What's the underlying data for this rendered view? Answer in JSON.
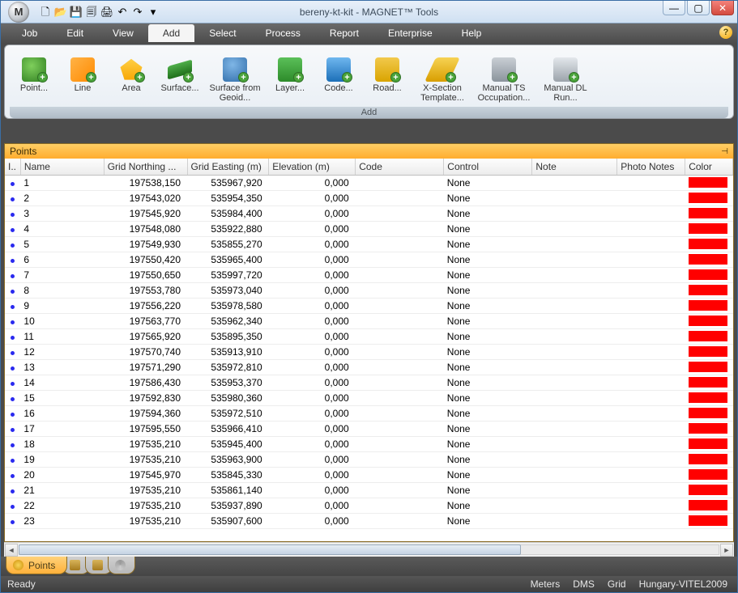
{
  "titlebar": {
    "app_initial": "M",
    "title": "bereny-kt-kit - MAGNET™ Tools",
    "qat": [
      "🗋",
      "📂",
      "💾",
      "🗐",
      "🖨",
      "↶",
      "↷",
      "▾"
    ]
  },
  "window_controls": {
    "min": "—",
    "max": "▢",
    "close": "✕"
  },
  "menu": {
    "items": [
      "Job",
      "Edit",
      "View",
      "Add",
      "Select",
      "Process",
      "Report",
      "Enterprise",
      "Help"
    ],
    "active": "Add",
    "help_icon": "?"
  },
  "ribbon": {
    "caption": "Add",
    "items": [
      {
        "label": "Point...",
        "icon": "ic-point"
      },
      {
        "label": "Line",
        "icon": "ic-line"
      },
      {
        "label": "Area",
        "icon": "ic-area"
      },
      {
        "label": "Surface...",
        "icon": "ic-surf"
      },
      {
        "label": "Surface from Geoid...",
        "icon": "ic-geoid",
        "wide": true
      },
      {
        "label": "Layer...",
        "icon": "ic-layer"
      },
      {
        "label": "Code...",
        "icon": "ic-code"
      },
      {
        "label": "Road...",
        "icon": "ic-road"
      },
      {
        "label": "X-Section Template...",
        "icon": "ic-xsec",
        "wide": true
      },
      {
        "label": "Manual TS Occupation...",
        "icon": "ic-ts",
        "wide": true
      },
      {
        "label": "Manual DL Run...",
        "icon": "ic-dl",
        "wide": true
      }
    ]
  },
  "panel": {
    "title": "Points",
    "pin": "⊣",
    "columns": [
      "I..",
      "Name",
      "Grid Northing ...",
      "Grid Easting (m)",
      "Elevation (m)",
      "Code",
      "Control",
      "Note",
      "Photo Notes",
      "Color"
    ],
    "rows": [
      {
        "name": "1",
        "n": "197538,150",
        "e": "535967,920",
        "el": "0,000",
        "code": "",
        "control": "None",
        "note": "",
        "photo": "",
        "color": "#ff0000"
      },
      {
        "name": "2",
        "n": "197543,020",
        "e": "535954,350",
        "el": "0,000",
        "code": "",
        "control": "None",
        "note": "",
        "photo": "",
        "color": "#ff0000"
      },
      {
        "name": "3",
        "n": "197545,920",
        "e": "535984,400",
        "el": "0,000",
        "code": "",
        "control": "None",
        "note": "",
        "photo": "",
        "color": "#ff0000"
      },
      {
        "name": "4",
        "n": "197548,080",
        "e": "535922,880",
        "el": "0,000",
        "code": "",
        "control": "None",
        "note": "",
        "photo": "",
        "color": "#ff0000"
      },
      {
        "name": "5",
        "n": "197549,930",
        "e": "535855,270",
        "el": "0,000",
        "code": "",
        "control": "None",
        "note": "",
        "photo": "",
        "color": "#ff0000"
      },
      {
        "name": "6",
        "n": "197550,420",
        "e": "535965,400",
        "el": "0,000",
        "code": "",
        "control": "None",
        "note": "",
        "photo": "",
        "color": "#ff0000"
      },
      {
        "name": "7",
        "n": "197550,650",
        "e": "535997,720",
        "el": "0,000",
        "code": "",
        "control": "None",
        "note": "",
        "photo": "",
        "color": "#ff0000"
      },
      {
        "name": "8",
        "n": "197553,780",
        "e": "535973,040",
        "el": "0,000",
        "code": "",
        "control": "None",
        "note": "",
        "photo": "",
        "color": "#ff0000"
      },
      {
        "name": "9",
        "n": "197556,220",
        "e": "535978,580",
        "el": "0,000",
        "code": "",
        "control": "None",
        "note": "",
        "photo": "",
        "color": "#ff0000"
      },
      {
        "name": "10",
        "n": "197563,770",
        "e": "535962,340",
        "el": "0,000",
        "code": "",
        "control": "None",
        "note": "",
        "photo": "",
        "color": "#ff0000"
      },
      {
        "name": "11",
        "n": "197565,920",
        "e": "535895,350",
        "el": "0,000",
        "code": "",
        "control": "None",
        "note": "",
        "photo": "",
        "color": "#ff0000"
      },
      {
        "name": "12",
        "n": "197570,740",
        "e": "535913,910",
        "el": "0,000",
        "code": "",
        "control": "None",
        "note": "",
        "photo": "",
        "color": "#ff0000"
      },
      {
        "name": "13",
        "n": "197571,290",
        "e": "535972,810",
        "el": "0,000",
        "code": "",
        "control": "None",
        "note": "",
        "photo": "",
        "color": "#ff0000"
      },
      {
        "name": "14",
        "n": "197586,430",
        "e": "535953,370",
        "el": "0,000",
        "code": "",
        "control": "None",
        "note": "",
        "photo": "",
        "color": "#ff0000"
      },
      {
        "name": "15",
        "n": "197592,830",
        "e": "535980,360",
        "el": "0,000",
        "code": "",
        "control": "None",
        "note": "",
        "photo": "",
        "color": "#ff0000"
      },
      {
        "name": "16",
        "n": "197594,360",
        "e": "535972,510",
        "el": "0,000",
        "code": "",
        "control": "None",
        "note": "",
        "photo": "",
        "color": "#ff0000"
      },
      {
        "name": "17",
        "n": "197595,550",
        "e": "535966,410",
        "el": "0,000",
        "code": "",
        "control": "None",
        "note": "",
        "photo": "",
        "color": "#ff0000"
      },
      {
        "name": "18",
        "n": "197535,210",
        "e": "535945,400",
        "el": "0,000",
        "code": "",
        "control": "None",
        "note": "",
        "photo": "",
        "color": "#ff0000"
      },
      {
        "name": "19",
        "n": "197535,210",
        "e": "535963,900",
        "el": "0,000",
        "code": "",
        "control": "None",
        "note": "",
        "photo": "",
        "color": "#ff0000"
      },
      {
        "name": "20",
        "n": "197545,970",
        "e": "535845,330",
        "el": "0,000",
        "code": "",
        "control": "None",
        "note": "",
        "photo": "",
        "color": "#ff0000"
      },
      {
        "name": "21",
        "n": "197535,210",
        "e": "535861,140",
        "el": "0,000",
        "code": "",
        "control": "None",
        "note": "",
        "photo": "",
        "color": "#ff0000"
      },
      {
        "name": "22",
        "n": "197535,210",
        "e": "535937,890",
        "el": "0,000",
        "code": "",
        "control": "None",
        "note": "",
        "photo": "",
        "color": "#ff0000"
      },
      {
        "name": "23",
        "n": "197535,210",
        "e": "535907,600",
        "el": "0,000",
        "code": "",
        "control": "None",
        "note": "",
        "photo": "",
        "color": "#ff0000"
      }
    ]
  },
  "tabs": {
    "active": "Points"
  },
  "status": {
    "left": "Ready",
    "cells": [
      "Meters",
      "DMS",
      "Grid",
      "Hungary-VITEL2009"
    ]
  }
}
